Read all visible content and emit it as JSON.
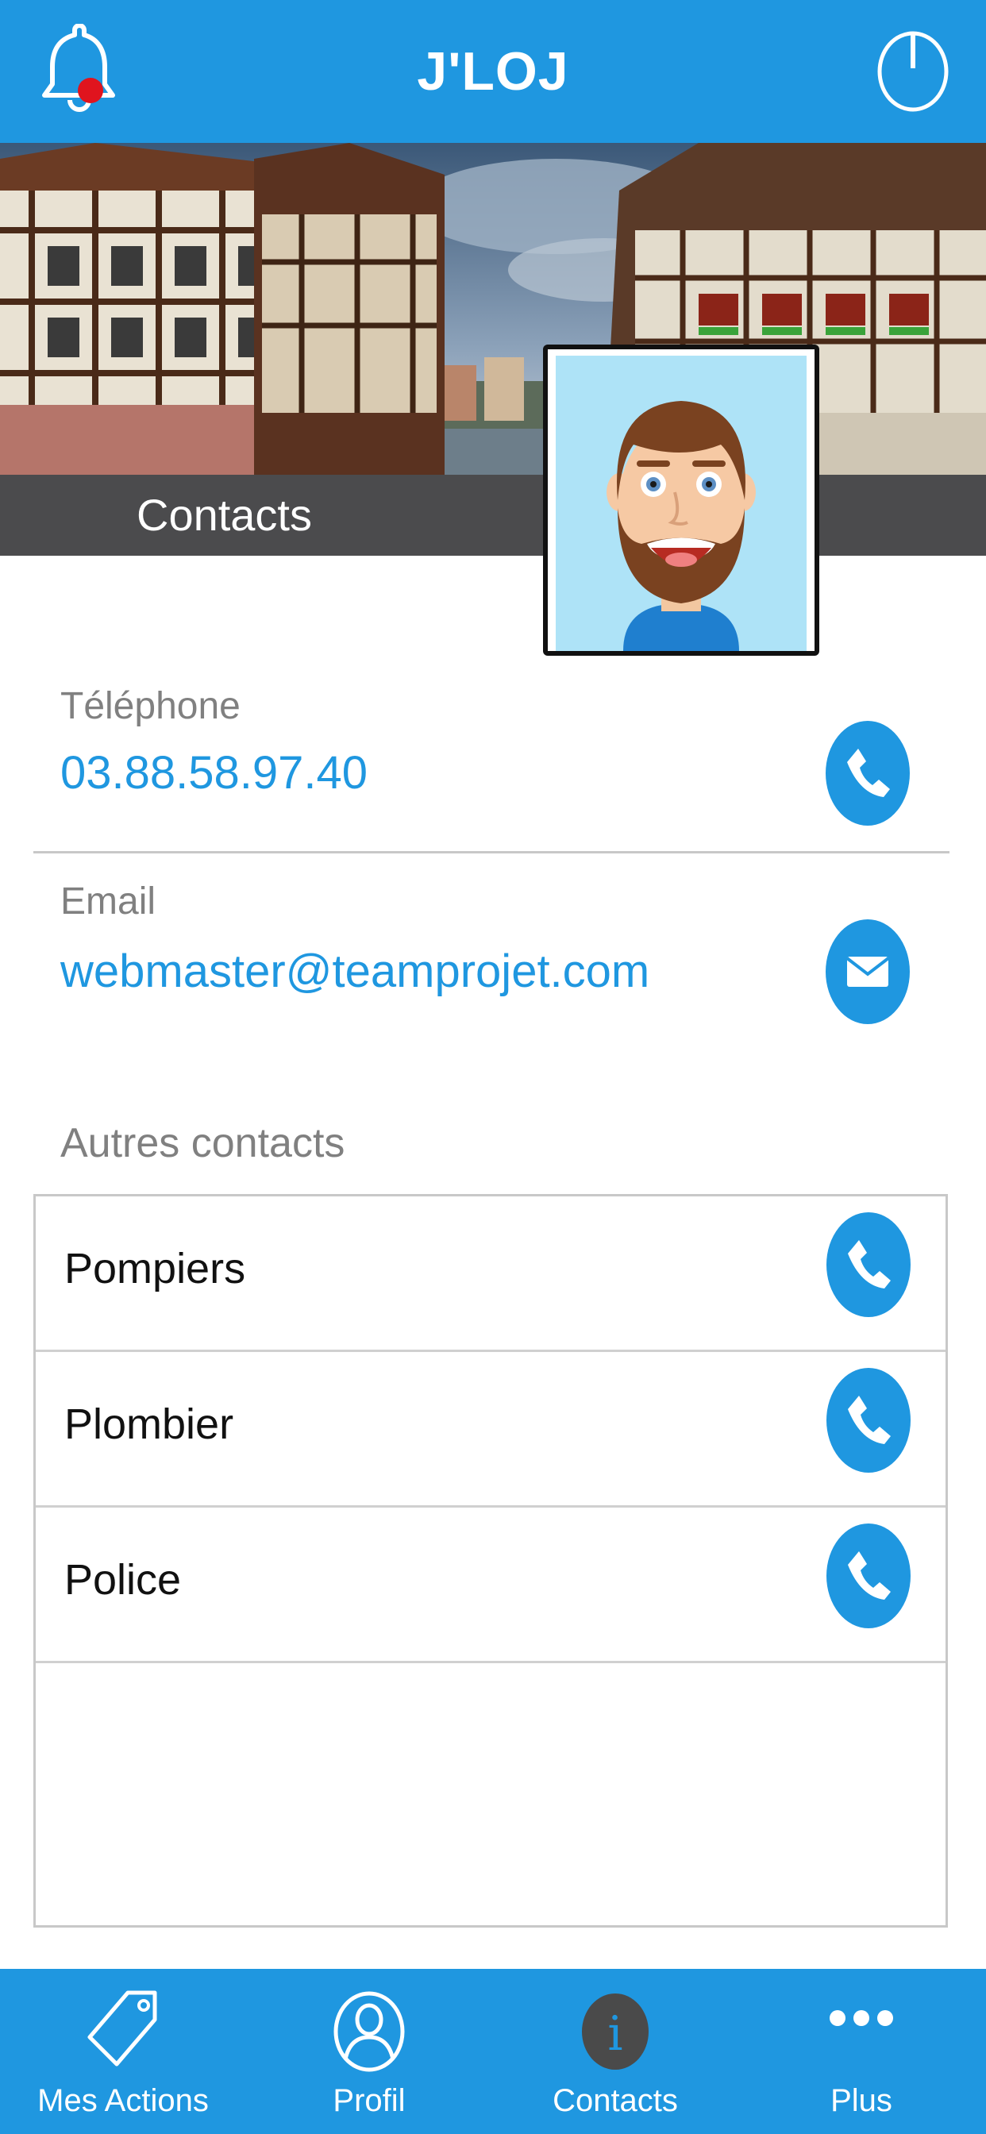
{
  "app": {
    "title": "J'LOJ"
  },
  "section": {
    "title": "Contacts"
  },
  "phone": {
    "label": "Téléphone",
    "value": "03.88.58.97.40"
  },
  "email": {
    "label": "Email",
    "value": "webmaster@teamprojet.com"
  },
  "others": {
    "label": "Autres contacts",
    "items": [
      {
        "name": "Pompiers"
      },
      {
        "name": "Plombier"
      },
      {
        "name": "Police"
      }
    ]
  },
  "tabs": [
    {
      "label": "Mes Actions",
      "icon": "tag-icon"
    },
    {
      "label": "Profil",
      "icon": "person-icon"
    },
    {
      "label": "Contacts",
      "icon": "info-icon",
      "active": true
    },
    {
      "label": "Plus",
      "icon": "more-dots-icon"
    }
  ],
  "colors": {
    "accent": "#1f97e0",
    "strip": "#4b4b4d",
    "notification_dot": "#e0141e",
    "active_tab_icon": "#4a4a4a"
  }
}
